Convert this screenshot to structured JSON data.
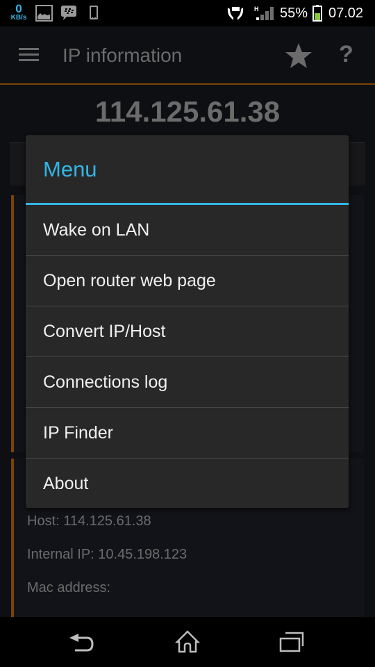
{
  "status_bar": {
    "network_speed_value": "0",
    "network_speed_unit": "KB/s",
    "notification_icons": [
      "gallery-icon",
      "bbm-chat-icon",
      "phone-device-icon"
    ],
    "system_icons": [
      "stamina-mode-icon",
      "signal-hspa-icon",
      "battery-icon"
    ],
    "network_type": "H",
    "battery_percent": "55%",
    "battery_level": 0.55,
    "battery_color": "#8cc63f",
    "time": "07.02"
  },
  "action_bar": {
    "title": "IP information",
    "menu_icon": "hamburger-icon",
    "actions": [
      {
        "name": "favorite",
        "icon": "star-icon"
      },
      {
        "name": "help",
        "icon": "help-icon",
        "glyph": "?"
      }
    ],
    "accent_color": "#7a4307"
  },
  "main": {
    "public_ip": "114.125.61.38",
    "details": [
      {
        "label": "Host:",
        "value": "114.125.61.38",
        "text": "Host: 114.125.61.38"
      },
      {
        "label": "Internal IP:",
        "value": "10.45.198.123",
        "text": "Internal IP: 10.45.198.123"
      },
      {
        "label": "Mac address:",
        "value": "",
        "text": "Mac address:"
      }
    ]
  },
  "dialog": {
    "title": "Menu",
    "accent_color": "#33b5e5",
    "items": [
      {
        "label": "Wake on LAN"
      },
      {
        "label": "Open router web page"
      },
      {
        "label": "Convert IP/Host"
      },
      {
        "label": "Connections log"
      },
      {
        "label": "IP Finder"
      },
      {
        "label": "About"
      }
    ]
  },
  "nav_bar": {
    "buttons": [
      {
        "name": "back",
        "icon": "back-icon"
      },
      {
        "name": "home",
        "icon": "home-icon"
      },
      {
        "name": "recents",
        "icon": "recent-apps-icon"
      }
    ]
  }
}
